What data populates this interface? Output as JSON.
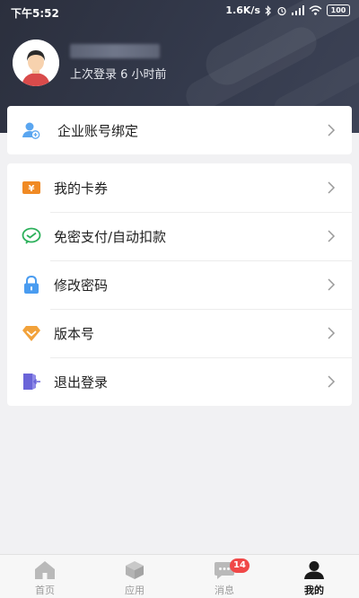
{
  "status_bar": {
    "time": "下午5:52",
    "network_speed": "1.6K/s",
    "battery_level": "100"
  },
  "profile": {
    "last_login": "上次登录 6 小时前"
  },
  "menu": {
    "enterprise_binding": "企业账号绑定",
    "items": [
      {
        "label": "我的卡券",
        "icon": "coupon-icon"
      },
      {
        "label": "免密支付/自动扣款",
        "icon": "wechat-pay-icon"
      },
      {
        "label": "修改密码",
        "icon": "lock-icon"
      },
      {
        "label": "版本号",
        "icon": "version-icon"
      },
      {
        "label": "退出登录",
        "icon": "logout-icon"
      }
    ]
  },
  "tabbar": {
    "tabs": [
      {
        "label": "首页",
        "icon": "home-icon"
      },
      {
        "label": "应用",
        "icon": "apps-cube-icon"
      },
      {
        "label": "消息",
        "icon": "message-icon",
        "badge": "14"
      },
      {
        "label": "我的",
        "icon": "profile-icon",
        "active": true
      }
    ]
  },
  "colors": {
    "header_bg": "#2b2f3d",
    "coupon": "#f08a24",
    "wechat": "#2bb05a",
    "lock": "#4a9cf0",
    "version": "#f2a23a",
    "logout": "#6a64d8",
    "badge": "#f04848"
  }
}
